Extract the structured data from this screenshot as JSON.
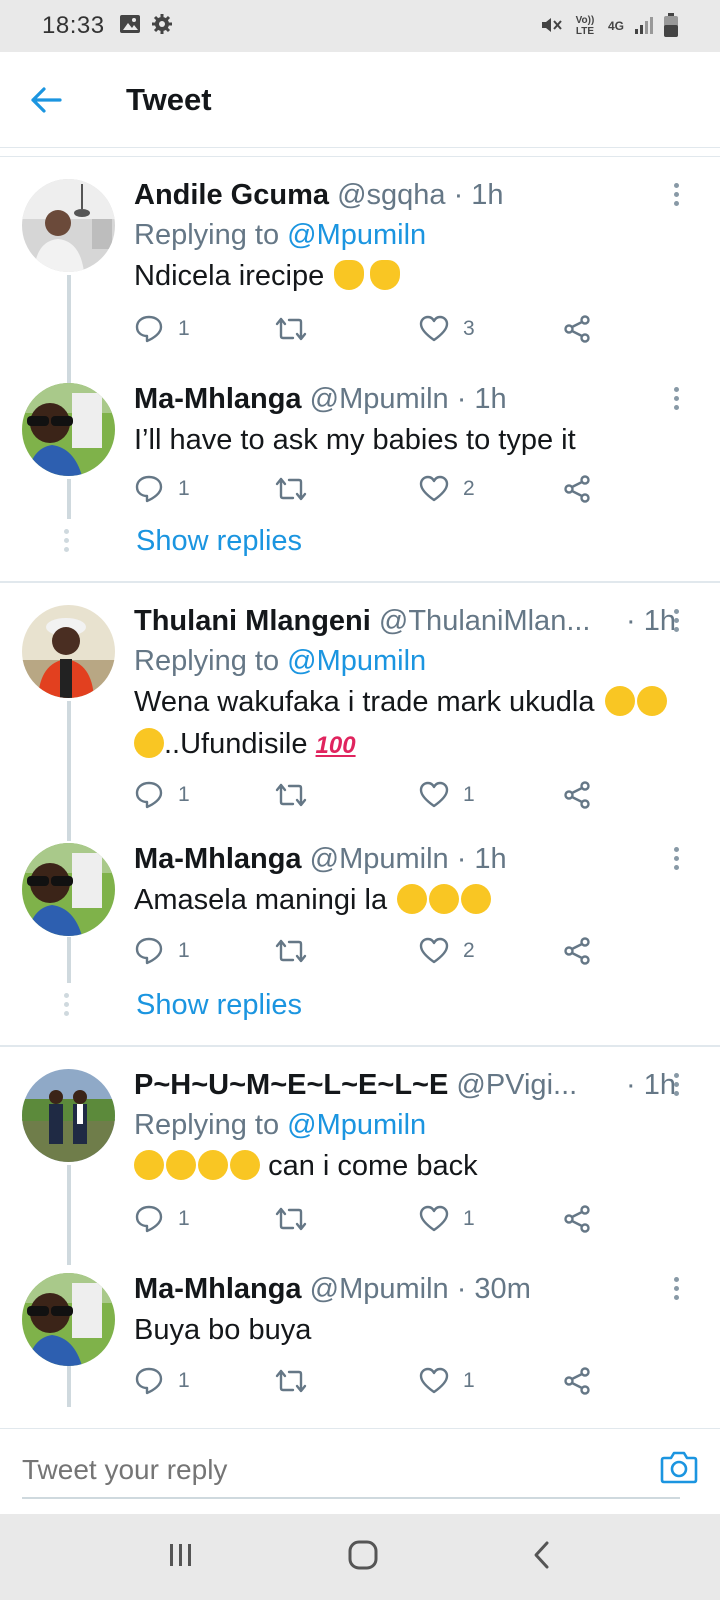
{
  "status_bar": {
    "time": "18:33",
    "icons": [
      "image-icon",
      "settings-icon",
      "mute-icon",
      "volte-icon",
      "4g-icon",
      "signal-icon",
      "battery-icon"
    ],
    "volte": "Vo)) LTE",
    "network": "4G"
  },
  "app_bar": {
    "back_icon": "arrow-left-icon",
    "title": "Tweet"
  },
  "colors": {
    "accent": "#1b95e0",
    "secondary_text": "#657786",
    "divider": "#e1e8ed"
  },
  "threads": [
    {
      "tweets": [
        {
          "name": "Andile Gcuma",
          "handle": "@sgqha",
          "time": "· 1h",
          "replying_prefix": "Replying to",
          "replying_to": "@Mpumiln",
          "text": "Ndicela irecipe",
          "emoji": [
            "ok-hand-emoji",
            "ok-hand-emoji"
          ],
          "replies": "1",
          "retweets": "",
          "likes": "3"
        },
        {
          "name": "Ma-Mhlanga",
          "handle": "@Mpumiln",
          "time": "· 1h",
          "text": "I’ll have to ask my babies to type it",
          "replies": "1",
          "retweets": "",
          "likes": "2"
        }
      ],
      "show_replies": "Show replies"
    },
    {
      "tweets": [
        {
          "name": "Thulani Mlangeni",
          "handle": "@ThulaniMlan...",
          "time": "· 1h",
          "replying_prefix": "Replying to",
          "replying_to": "@Mpumiln",
          "text_a": "Wena wakufaka i trade mark ukudla",
          "text_b": "..Ufundisile",
          "emoji": [
            "rofl-emoji",
            "rofl-emoji",
            "rofl-emoji",
            "hundred-points-emoji"
          ],
          "replies": "1",
          "retweets": "",
          "likes": "1"
        },
        {
          "name": "Ma-Mhlanga",
          "handle": "@Mpumiln",
          "time": "· 1h",
          "text": "Amasela maningi la",
          "emoji": [
            "rofl-emoji",
            "rofl-emoji",
            "rofl-emoji"
          ],
          "replies": "1",
          "retweets": "",
          "likes": "2"
        }
      ],
      "show_replies": "Show replies"
    },
    {
      "tweets": [
        {
          "name": "P~H~U~M~E~L~E~L~E",
          "handle": "@PVigi...",
          "time": "· 1h",
          "replying_prefix": "Replying to",
          "replying_to": "@Mpumiln",
          "text": "can i come back",
          "emoji": [
            "yum-emoji",
            "yum-emoji",
            "yum-emoji",
            "yum-emoji"
          ],
          "replies": "1",
          "retweets": "",
          "likes": "1"
        },
        {
          "name": "Ma-Mhlanga",
          "handle": "@Mpumiln",
          "time": "· 30m",
          "text": "Buya bo buya",
          "replies": "1",
          "retweets": "",
          "likes": "1"
        }
      ]
    }
  ],
  "reply_bar": {
    "placeholder": "Tweet your reply",
    "camera_icon": "camera-icon"
  },
  "nav_bar": {
    "icons": [
      "recent-apps-icon",
      "home-icon",
      "back-icon"
    ]
  }
}
